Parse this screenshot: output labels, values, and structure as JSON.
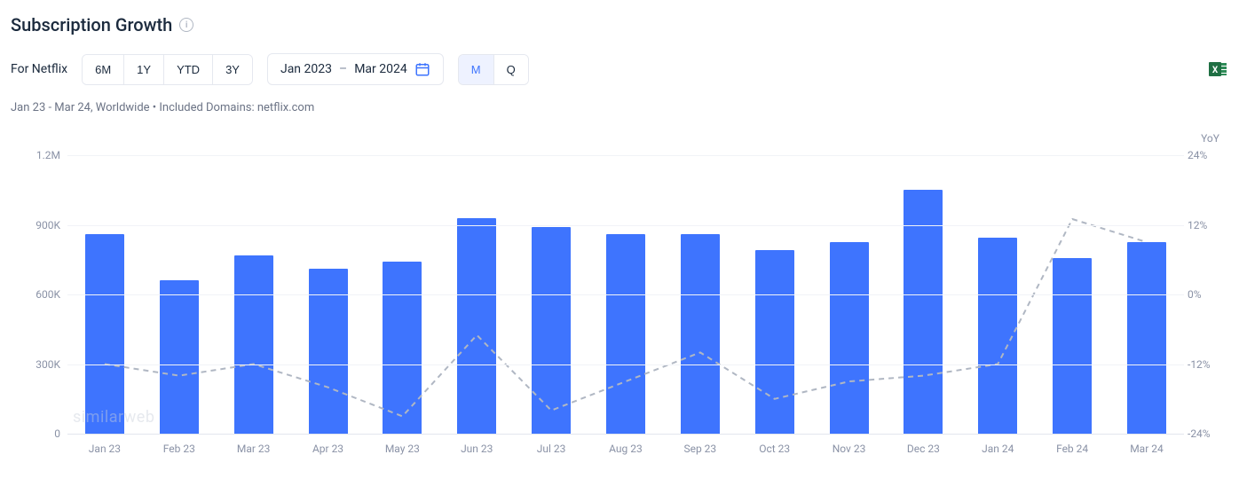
{
  "header": {
    "title": "Subscription Growth"
  },
  "controls": {
    "for_label": "For Netflix",
    "time_ranges": [
      "6M",
      "1Y",
      "YTD",
      "3Y"
    ],
    "date_start": "Jan 2023",
    "date_end": "Mar 2024",
    "granularity": {
      "options": [
        "M",
        "Q"
      ],
      "active": "M"
    }
  },
  "subline": "Jan 23 - Mar 24, Worldwide • Included Domains: netflix.com",
  "axis_right_title": "YoY",
  "watermark": "similarweb",
  "chart_data": {
    "type": "bar",
    "categories": [
      "Jan 23",
      "Feb 23",
      "Mar 23",
      "Apr 23",
      "May 23",
      "Jun 23",
      "Jul 23",
      "Aug 23",
      "Sep 23",
      "Oct 23",
      "Nov 23",
      "Dec 23",
      "Jan 24",
      "Feb 24",
      "Mar 24"
    ],
    "series": [
      {
        "name": "Subscriptions",
        "axis": "left",
        "type": "bar",
        "values": [
          860000,
          660000,
          770000,
          710000,
          740000,
          930000,
          890000,
          860000,
          860000,
          790000,
          825000,
          1050000,
          845000,
          755000,
          825000
        ]
      },
      {
        "name": "YoY",
        "axis": "right",
        "type": "line",
        "values": [
          -12,
          -14,
          -12,
          -16,
          -21,
          -7,
          -20,
          -15,
          -10,
          -18,
          -15,
          -14,
          -12,
          13,
          9
        ]
      }
    ],
    "ylabel": "",
    "yticks_left": [
      "0",
      "300K",
      "600K",
      "900K",
      "1.2M"
    ],
    "ylim_left": [
      0,
      1200000
    ],
    "yticks_right": [
      "-24%",
      "-12%",
      "0%",
      "12%",
      "24%"
    ],
    "ylim_right": [
      -24,
      24
    ],
    "xlabel": ""
  },
  "colors": {
    "bar": "#3e74fe",
    "line": "#b0b7c3",
    "accent": "#3e74fe"
  }
}
